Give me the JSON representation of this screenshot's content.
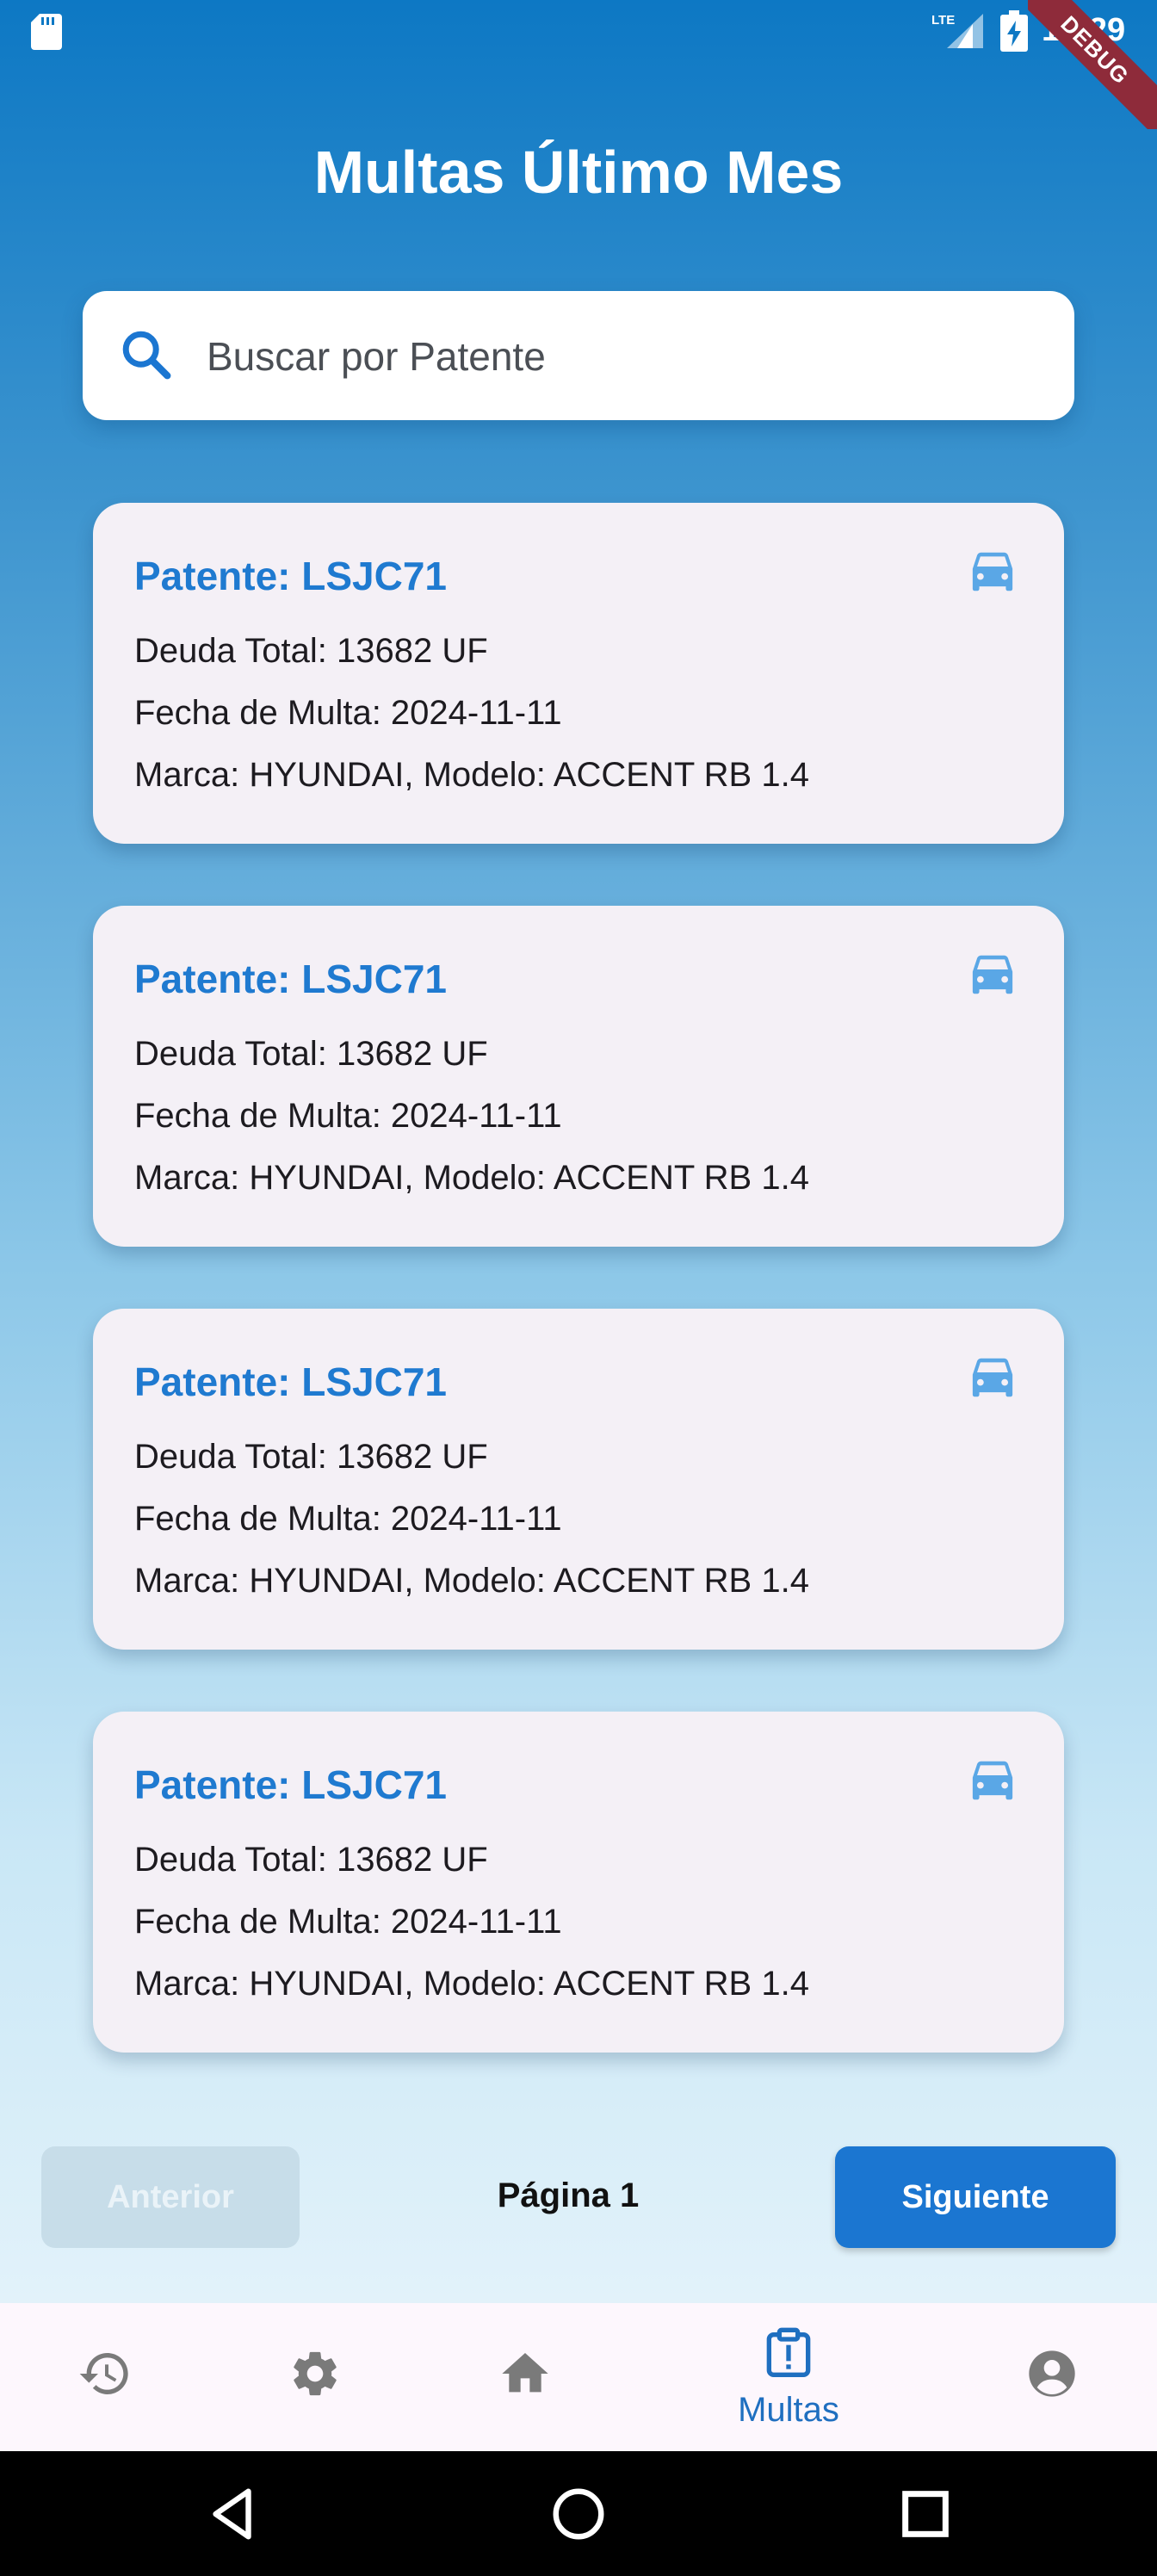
{
  "status_bar": {
    "time": "12:29",
    "network": "LTE",
    "debug_banner": "DEBUG"
  },
  "page": {
    "title": "Multas Último Mes"
  },
  "search": {
    "placeholder": "Buscar por Patente",
    "value": ""
  },
  "cards": [
    {
      "title": "Patente: LSJC71",
      "deuda": "Deuda Total: 13682 UF",
      "fecha": "Fecha de Multa: 2024-11-11",
      "vehiculo": "Marca: HYUNDAI, Modelo: ACCENT RB 1.4"
    },
    {
      "title": "Patente: LSJC71",
      "deuda": "Deuda Total: 13682 UF",
      "fecha": "Fecha de Multa: 2024-11-11",
      "vehiculo": "Marca: HYUNDAI, Modelo: ACCENT RB 1.4"
    },
    {
      "title": "Patente: LSJC71",
      "deuda": "Deuda Total: 13682 UF",
      "fecha": "Fecha de Multa: 2024-11-11",
      "vehiculo": "Marca: HYUNDAI, Modelo: ACCENT RB 1.4"
    },
    {
      "title": "Patente: LSJC71",
      "deuda": "Deuda Total: 13682 UF",
      "fecha": "Fecha de Multa: 2024-11-11",
      "vehiculo": "Marca: HYUNDAI, Modelo: ACCENT RB 1.4"
    }
  ],
  "pager": {
    "prev_label": "Anterior",
    "page_label": "Página 1",
    "next_label": "Siguiente"
  },
  "bottom_nav": {
    "items": [
      {
        "icon": "history-icon",
        "label": ""
      },
      {
        "icon": "settings-icon",
        "label": ""
      },
      {
        "icon": "home-icon",
        "label": ""
      },
      {
        "icon": "report-icon",
        "label": "Multas",
        "active": true
      },
      {
        "icon": "account-icon",
        "label": ""
      }
    ]
  },
  "colors": {
    "accent": "#1b76d1",
    "card_title": "#1f7ad0",
    "car_icon": "#5aa7e6",
    "nav_inactive": "#7a7a7a",
    "debug_banner": "#8e2b3a"
  }
}
